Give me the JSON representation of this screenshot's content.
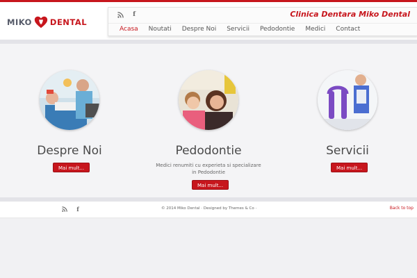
{
  "brand": {
    "logo_left": "MIKO",
    "logo_right": "DENTAL",
    "clinic_title": "Clinica Dentara Miko Dental",
    "accent_color": "#c7161d"
  },
  "header": {
    "social_icons": [
      "rss-icon",
      "facebook-icon"
    ],
    "nav": [
      {
        "label": "Acasa",
        "active": true
      },
      {
        "label": "Noutati",
        "active": false
      },
      {
        "label": "Despre Noi",
        "active": false
      },
      {
        "label": "Servicii",
        "active": false
      },
      {
        "label": "Pedodontie",
        "active": false
      },
      {
        "label": "Medici",
        "active": false
      },
      {
        "label": "Contact",
        "active": false
      }
    ]
  },
  "features": [
    {
      "title": "Despre Noi",
      "description": "",
      "button": "Mai mult..."
    },
    {
      "title": "Pedodontie",
      "description": "Medici renumiti cu experieta si specializare in Pedodontie",
      "button": "Mai mult..."
    },
    {
      "title": "Servicii",
      "description": "",
      "button": "Mai mult..."
    }
  ],
  "footer": {
    "social_icons": [
      "rss-icon",
      "facebook-icon"
    ],
    "copyright": "© 2014 Miko Dental · Designed by Themes & Co ·",
    "back_to_top": "Back to top"
  }
}
